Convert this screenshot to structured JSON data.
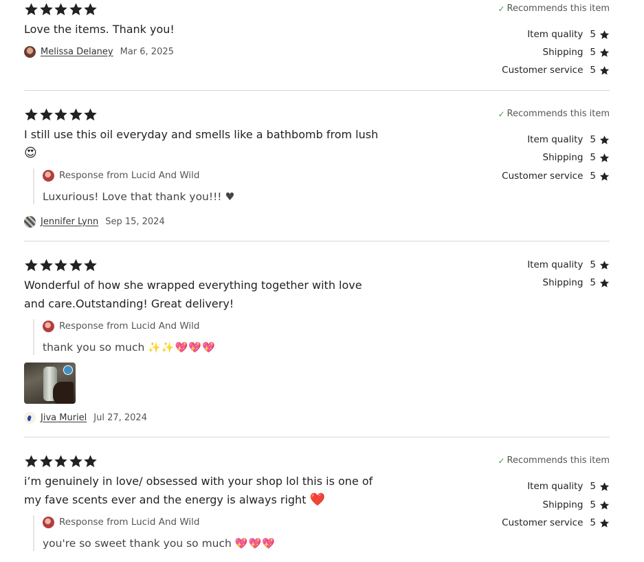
{
  "reviews": [
    {
      "rating": 5,
      "text": "Love the items. Thank you!",
      "text_emoji": "",
      "recommends": "Recommends this item",
      "author": {
        "name": "Melissa Delaney",
        "date": "Mar 6, 2025"
      },
      "ratings": [
        {
          "label": "Item quality",
          "value": "5"
        },
        {
          "label": "Shipping",
          "value": "5"
        },
        {
          "label": "Customer service",
          "value": "5"
        }
      ]
    },
    {
      "rating": 5,
      "text": "I still use this oil everyday and smells like a bathbomb from lush",
      "text_emoji": "😍",
      "recommends": "Recommends this item",
      "response": {
        "from": "Response from Lucid And Wild",
        "text": "Luxurious! Love that thank you!!! ♥",
        "emojis": ""
      },
      "author": {
        "name": "Jennifer Lynn",
        "date": "Sep 15, 2024"
      },
      "ratings": [
        {
          "label": "Item quality",
          "value": "5"
        },
        {
          "label": "Shipping",
          "value": "5"
        },
        {
          "label": "Customer service",
          "value": "5"
        }
      ]
    },
    {
      "rating": 5,
      "text": "Wonderful of how she wrapped everything together with love and care.Outstanding! Great delivery!",
      "text_emoji": "",
      "response": {
        "from": "Response from Lucid And Wild",
        "text": "thank you so much",
        "emojis": "✨✨💖💖💖"
      },
      "has_photo": true,
      "author": {
        "name": "Jiva Muriel",
        "date": "Jul 27, 2024"
      },
      "ratings": [
        {
          "label": "Item quality",
          "value": "5"
        },
        {
          "label": "Shipping",
          "value": "5"
        }
      ]
    },
    {
      "rating": 5,
      "text": "i’m genuinely in love/ obsessed with your shop lol this is one of my fave scents ever and the energy is always right",
      "text_emoji": "❤️",
      "recommends": "Recommends this item",
      "response": {
        "from": "Response from Lucid And Wild",
        "text": "you're so sweet thank you so much",
        "emojis": "💖💖💖"
      },
      "ratings": [
        {
          "label": "Item quality",
          "value": "5"
        },
        {
          "label": "Shipping",
          "value": "5"
        },
        {
          "label": "Customer service",
          "value": "5"
        }
      ]
    }
  ]
}
